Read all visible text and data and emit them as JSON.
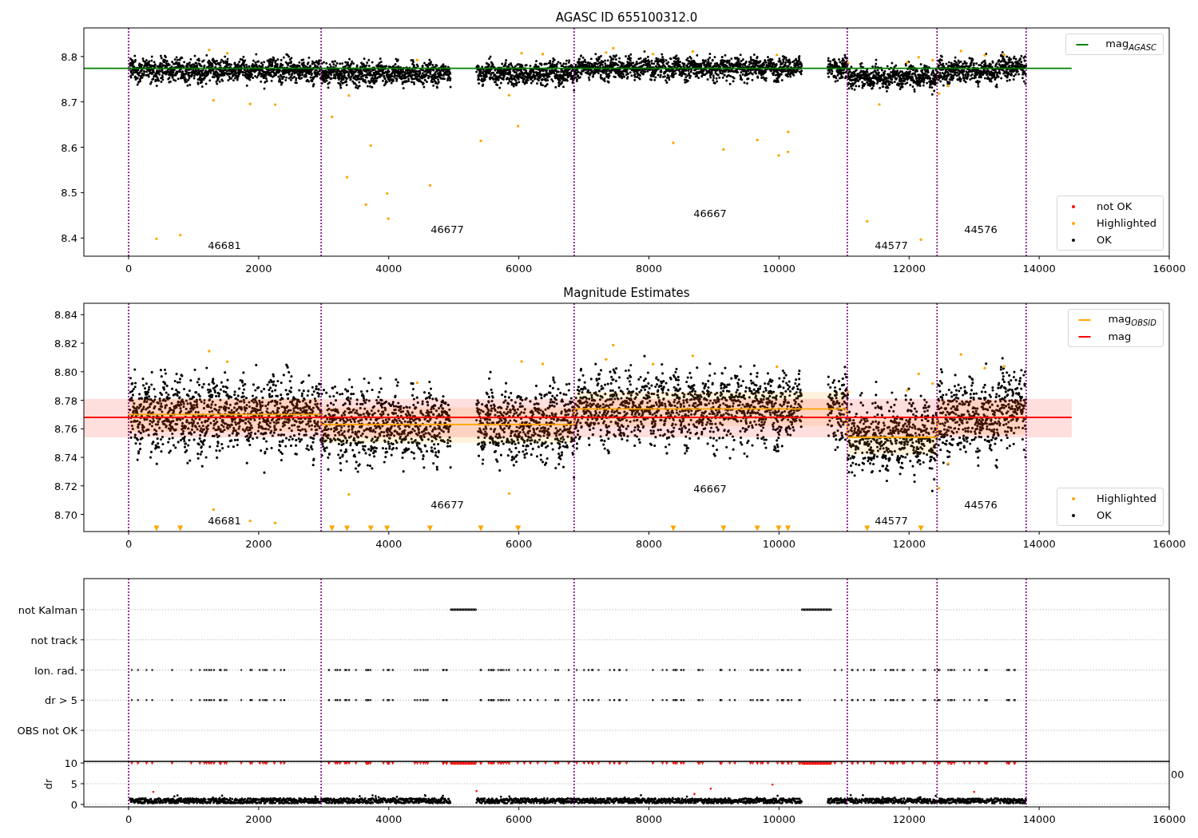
{
  "charts": [
    {
      "kind": "mag",
      "chart_data": {
        "type": "scatter",
        "title": "AGASC ID 655100312.0",
        "xlim": [
          -688,
          16000
        ],
        "ylim": [
          8.36,
          8.863
        ],
        "xticks": [
          {
            "value": 0,
            "label": "0"
          },
          {
            "value": 2000,
            "label": "2000"
          },
          {
            "value": 4000,
            "label": "4000"
          },
          {
            "value": 6000,
            "label": "6000"
          },
          {
            "value": 8000,
            "label": "8000"
          },
          {
            "value": 10000,
            "label": "10000"
          },
          {
            "value": 12000,
            "label": "12000"
          },
          {
            "value": 14000,
            "label": "14000"
          },
          {
            "value": 16000,
            "label": "16000"
          }
        ],
        "yticks": [
          {
            "value": 8.4,
            "label": "8.4"
          },
          {
            "value": 8.5,
            "label": "8.5"
          },
          {
            "value": 8.6,
            "label": "8.6"
          },
          {
            "value": 8.7,
            "label": "8.7"
          },
          {
            "value": 8.8,
            "label": "8.8"
          }
        ],
        "series": [
          {
            "name": "mag$_{AGASC}$",
            "type": "line",
            "color": "#008000",
            "x": [
              -688,
              14500
            ],
            "values": [
              8.774,
              8.774
            ]
          }
        ],
        "ref_lines": [
          {
            "axis": "x",
            "value": 0,
            "color": "#800080"
          },
          {
            "axis": "x",
            "value": 2960,
            "color": "#800080"
          },
          {
            "axis": "x",
            "value": 6850,
            "color": "#800080"
          },
          {
            "axis": "x",
            "value": 11050,
            "color": "#800080"
          },
          {
            "axis": "x",
            "value": 12430,
            "color": "#800080"
          },
          {
            "axis": "x",
            "value": 13800,
            "color": "#800080"
          }
        ],
        "annotations": [
          "46681",
          "46677",
          "46667",
          "44577",
          "44576"
        ]
      },
      "legend_markers": [
        {
          "label": "not OK",
          "color": "#ff0000"
        },
        {
          "label": "Highlighted",
          "color": "#ffa500"
        },
        {
          "label": "OK",
          "color": "#000000"
        }
      ]
    },
    {
      "kind": "mag",
      "chart_data": {
        "type": "scatter",
        "title": "Magnitude Estimates",
        "xlim": [
          -688,
          16000
        ],
        "ylim": [
          8.688,
          8.848
        ],
        "xticks": [
          {
            "value": 0,
            "label": "0"
          },
          {
            "value": 2000,
            "label": "2000"
          },
          {
            "value": 4000,
            "label": "4000"
          },
          {
            "value": 6000,
            "label": "6000"
          },
          {
            "value": 8000,
            "label": "8000"
          },
          {
            "value": 10000,
            "label": "10000"
          },
          {
            "value": 12000,
            "label": "12000"
          },
          {
            "value": 14000,
            "label": "14000"
          },
          {
            "value": 16000,
            "label": "16000"
          }
        ],
        "yticks": [
          {
            "value": 8.7,
            "label": "8.70"
          },
          {
            "value": 8.72,
            "label": "8.72"
          },
          {
            "value": 8.74,
            "label": "8.74"
          },
          {
            "value": 8.76,
            "label": "8.76"
          },
          {
            "value": 8.78,
            "label": "8.78"
          },
          {
            "value": 8.8,
            "label": "8.80"
          },
          {
            "value": 8.82,
            "label": "8.82"
          },
          {
            "value": 8.84,
            "label": "8.84"
          }
        ],
        "series": [
          {
            "name": "mag$_{OBSID}$",
            "type": "line",
            "color": "#ffa500",
            "x": [
              0,
              2960,
              2960,
              6850,
              6850,
              11050,
              11050,
              12430,
              12430,
              13800
            ],
            "values": [
              8.77,
              8.77,
              8.763,
              8.763,
              8.774,
              8.774,
              8.754,
              8.754,
              8.768,
              8.768
            ]
          },
          {
            "name": "mag",
            "type": "line",
            "color": "#ff0000",
            "x": [
              -688,
              14500
            ],
            "values": [
              8.768,
              8.768
            ]
          }
        ],
        "bands": [
          {
            "axis": "y",
            "from": 8.758,
            "to": 8.781,
            "color": "#ffa500"
          },
          {
            "axis": "y",
            "from": 8.75,
            "to": 8.775,
            "color": "#ffa500"
          },
          {
            "axis": "y",
            "from": 8.762,
            "to": 8.786,
            "color": "#ffa500"
          },
          {
            "axis": "y",
            "from": 8.742,
            "to": 8.767,
            "color": "#ffa500"
          },
          {
            "axis": "y",
            "from": 8.756,
            "to": 8.78,
            "color": "#ffa500"
          },
          {
            "axis": "y",
            "from": 8.754,
            "to": 8.781,
            "color": "#ff0000"
          }
        ],
        "ref_lines": [
          {
            "axis": "x",
            "value": 0,
            "color": "#800080"
          },
          {
            "axis": "x",
            "value": 2960,
            "color": "#800080"
          },
          {
            "axis": "x",
            "value": 6850,
            "color": "#800080"
          },
          {
            "axis": "x",
            "value": 11050,
            "color": "#800080"
          },
          {
            "axis": "x",
            "value": 12430,
            "color": "#800080"
          },
          {
            "axis": "x",
            "value": 13800,
            "color": "#800080"
          }
        ],
        "annotations": [
          "46681",
          "46677",
          "46667",
          "44577",
          "44576"
        ]
      },
      "legend_markers": [
        {
          "label": "Highlighted",
          "color": "#ffa500"
        },
        {
          "label": "OK",
          "color": "#000000"
        }
      ]
    },
    {
      "kind": "flags",
      "clipped_label": "00",
      "chart_data": {
        "type": "scatter",
        "orientation": "horizontal",
        "xlim": [
          -688,
          16000
        ],
        "categories": [
          "not Kalman",
          "not track",
          "Ion. rad.",
          "dr > 5",
          "OBS not OK"
        ],
        "ref_lines": [
          {
            "axis": "x",
            "value": 0,
            "color": "#800080"
          },
          {
            "axis": "x",
            "value": 2960,
            "color": "#800080"
          },
          {
            "axis": "x",
            "value": 6850,
            "color": "#800080"
          },
          {
            "axis": "x",
            "value": 11050,
            "color": "#800080"
          },
          {
            "axis": "x",
            "value": 12430,
            "color": "#800080"
          },
          {
            "axis": "x",
            "value": 13800,
            "color": "#800080"
          }
        ]
      }
    },
    {
      "kind": "dr",
      "chart_data": {
        "type": "scatter",
        "ylabel": "dr",
        "xlim": [
          -688,
          16000
        ],
        "ylim": [
          -0.6,
          10.4
        ],
        "xticks": [
          {
            "value": 0,
            "label": "0"
          },
          {
            "value": 2000,
            "label": "2000"
          },
          {
            "value": 4000,
            "label": "4000"
          },
          {
            "value": 6000,
            "label": "6000"
          },
          {
            "value": 8000,
            "label": "8000"
          },
          {
            "value": 10000,
            "label": "10000"
          },
          {
            "value": 12000,
            "label": "12000"
          },
          {
            "value": 14000,
            "label": "14000"
          },
          {
            "value": 16000,
            "label": "16000"
          }
        ],
        "yticks": [
          {
            "value": 0,
            "label": "0"
          },
          {
            "value": 5,
            "label": "5"
          },
          {
            "value": 10,
            "label": "10"
          }
        ],
        "ref_lines": [
          {
            "axis": "x",
            "value": 0,
            "color": "#800080"
          },
          {
            "axis": "x",
            "value": 2960,
            "color": "#800080"
          },
          {
            "axis": "x",
            "value": 6850,
            "color": "#800080"
          },
          {
            "axis": "x",
            "value": 11050,
            "color": "#800080"
          },
          {
            "axis": "x",
            "value": 12430,
            "color": "#800080"
          },
          {
            "axis": "x",
            "value": 13800,
            "color": "#800080"
          }
        ]
      }
    }
  ]
}
